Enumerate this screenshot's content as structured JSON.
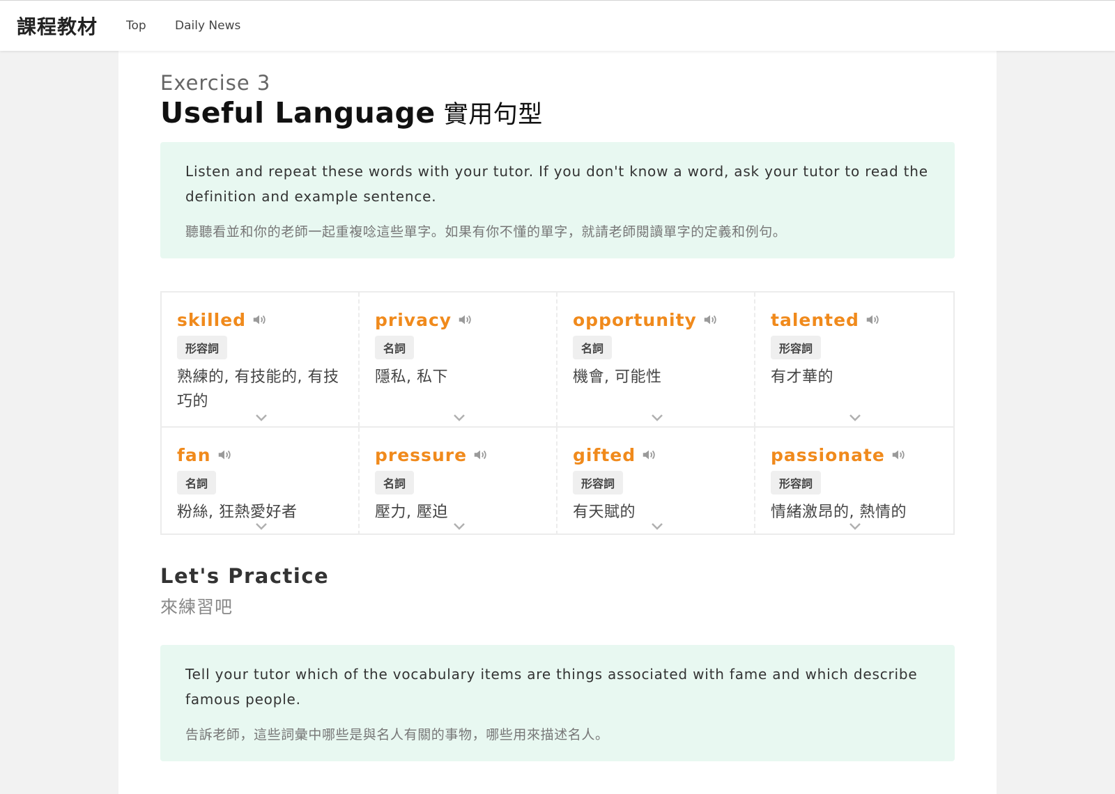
{
  "nav": {
    "brand": "課程教材",
    "links": [
      "Top",
      "Daily News"
    ]
  },
  "exercise": {
    "label": "Exercise 3",
    "title_en": "Useful Language",
    "title_zh": "實用句型"
  },
  "intro": {
    "en": "Listen and repeat these words with your tutor. If you don't know a word, ask your tutor to read the definition and example sentence.",
    "zh": "聽聽看並和你的老師一起重複唸這些單字。如果有你不懂的單字，就請老師閱讀單字的定義和例句。"
  },
  "vocab": [
    {
      "word": "skilled",
      "pos": "形容詞",
      "meaning": "熟練的, 有技能的, 有技巧的"
    },
    {
      "word": "privacy",
      "pos": "名詞",
      "meaning": "隱私, 私下"
    },
    {
      "word": "opportunity",
      "pos": "名詞",
      "meaning": "機會, 可能性"
    },
    {
      "word": "talented",
      "pos": "形容詞",
      "meaning": "有才華的"
    },
    {
      "word": "fan",
      "pos": "名詞",
      "meaning": "粉絲, 狂熱愛好者"
    },
    {
      "word": "pressure",
      "pos": "名詞",
      "meaning": "壓力, 壓迫"
    },
    {
      "word": "gifted",
      "pos": "形容詞",
      "meaning": "有天賦的"
    },
    {
      "word": "passionate",
      "pos": "形容詞",
      "meaning": "情緒激昂的, 熱情的"
    }
  ],
  "practice": {
    "title": "Let's Practice",
    "subtitle": "來練習吧",
    "en": "Tell your tutor which of the vocabulary items are things associated with fame and which describe famous people.",
    "zh": "告訴老師，這些詞彙中哪些是與名人有關的事物，哪些用來描述名人。"
  },
  "colors": {
    "accent_word": "#f08a1c",
    "info_box_bg": "#e8f8f1"
  },
  "icons": {
    "speaker": "speaker-icon",
    "expand": "chevron-down-icon"
  }
}
